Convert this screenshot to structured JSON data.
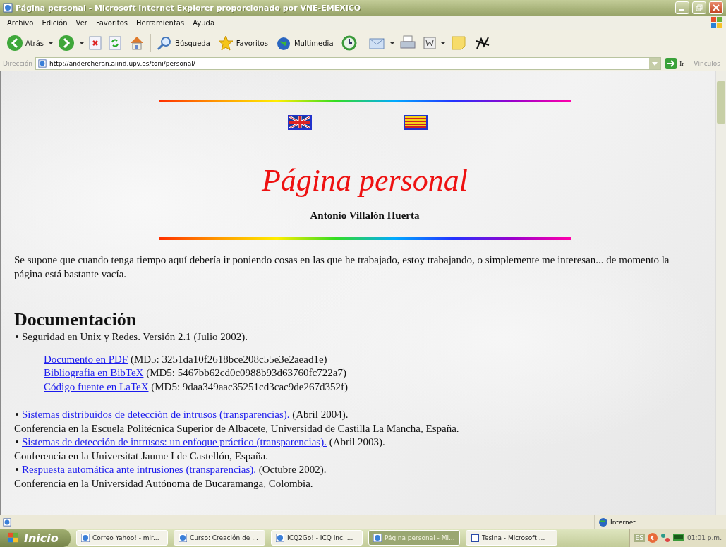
{
  "window": {
    "title": "Página personal - Microsoft Internet Explorer proporcionado por VNE-EMEXICO"
  },
  "menu": [
    "Archivo",
    "Edición",
    "Ver",
    "Favoritos",
    "Herramientas",
    "Ayuda"
  ],
  "toolbar": [
    {
      "kind": "back",
      "label": "Atrás",
      "dropdown": true
    },
    {
      "kind": "forward",
      "dropdown": true
    },
    {
      "kind": "stop"
    },
    {
      "kind": "refresh"
    },
    {
      "kind": "home"
    },
    {
      "kind": "sep"
    },
    {
      "kind": "search",
      "label": "Búsqueda"
    },
    {
      "kind": "favorites",
      "label": "Favoritos"
    },
    {
      "kind": "media",
      "label": "Multimedia"
    },
    {
      "kind": "history"
    },
    {
      "kind": "sep"
    },
    {
      "kind": "mail",
      "dropdown": true
    },
    {
      "kind": "print"
    },
    {
      "kind": "word",
      "dropdown": true
    },
    {
      "kind": "note"
    },
    {
      "kind": "tool"
    }
  ],
  "address": {
    "label": "Dirección",
    "value": "http://andercheran.aiind.upv.es/toni/personal/",
    "go": "Ir",
    "links": "Vínculos"
  },
  "page": {
    "title": "Página personal",
    "author": "Antonio Villalón Huerta",
    "intro": "Se supone que cuando tenga tiempo aquí debería ir poniendo cosas en las que he trabajado, estoy trabajando, o simplemente me interesan... de momento la página está bastante vacía.",
    "section": "Documentación",
    "items": [
      {
        "text": "Seguridad en Unix y Redes. Versión 2.1 (Julio 2002).",
        "files": [
          {
            "link": "Documento en PDF",
            "note": "(MD5: 3251da10f2618bce208c55e3e2aead1e)"
          },
          {
            "link": "Bibliografia en BibTeX",
            "note": "(MD5: 5467bb62cd0c0988b93d63760fc722a7)"
          },
          {
            "link": "Código fuente en LaTeX",
            "note": "(MD5: 9daa349aac35251cd3cac9de267d352f)"
          }
        ]
      },
      {
        "link": "Sistemas distribuidos de detección de intrusos (transparencias).",
        "note": "(Abril 2004).",
        "detail": "Conferencia en la Escuela Politécnica Superior de Albacete, Universidad de Castilla La Mancha, España."
      },
      {
        "link": "Sistemas de detección de intrusos: un enfoque práctico (transparencias).",
        "note": "(Abril 2003).",
        "detail": "Conferencia en la Universitat Jaume I de Castellón, España."
      },
      {
        "link": "Respuesta automática ante intrusiones (transparencias).",
        "note": "(Octubre 2002).",
        "detail": "Conferencia en la Universidad Autónoma de Bucaramanga, Colombia."
      }
    ]
  },
  "status": {
    "zone": "Internet"
  },
  "taskbar": {
    "start": "Inicio",
    "tasks": [
      {
        "label": "Correo Yahoo! - mir...",
        "kind": "browser",
        "selected": false
      },
      {
        "label": "Curso: Creación de ...",
        "kind": "browser",
        "selected": false
      },
      {
        "label": "ICQ2Go! - ICQ Inc. ...",
        "kind": "browser",
        "selected": false
      },
      {
        "label": "Página personal - Mi...",
        "kind": "browser",
        "selected": true
      },
      {
        "label": "Tesina - Microsoft ...",
        "kind": "word",
        "selected": false
      }
    ],
    "lang": "ES",
    "clock": "01:01 p.m."
  }
}
